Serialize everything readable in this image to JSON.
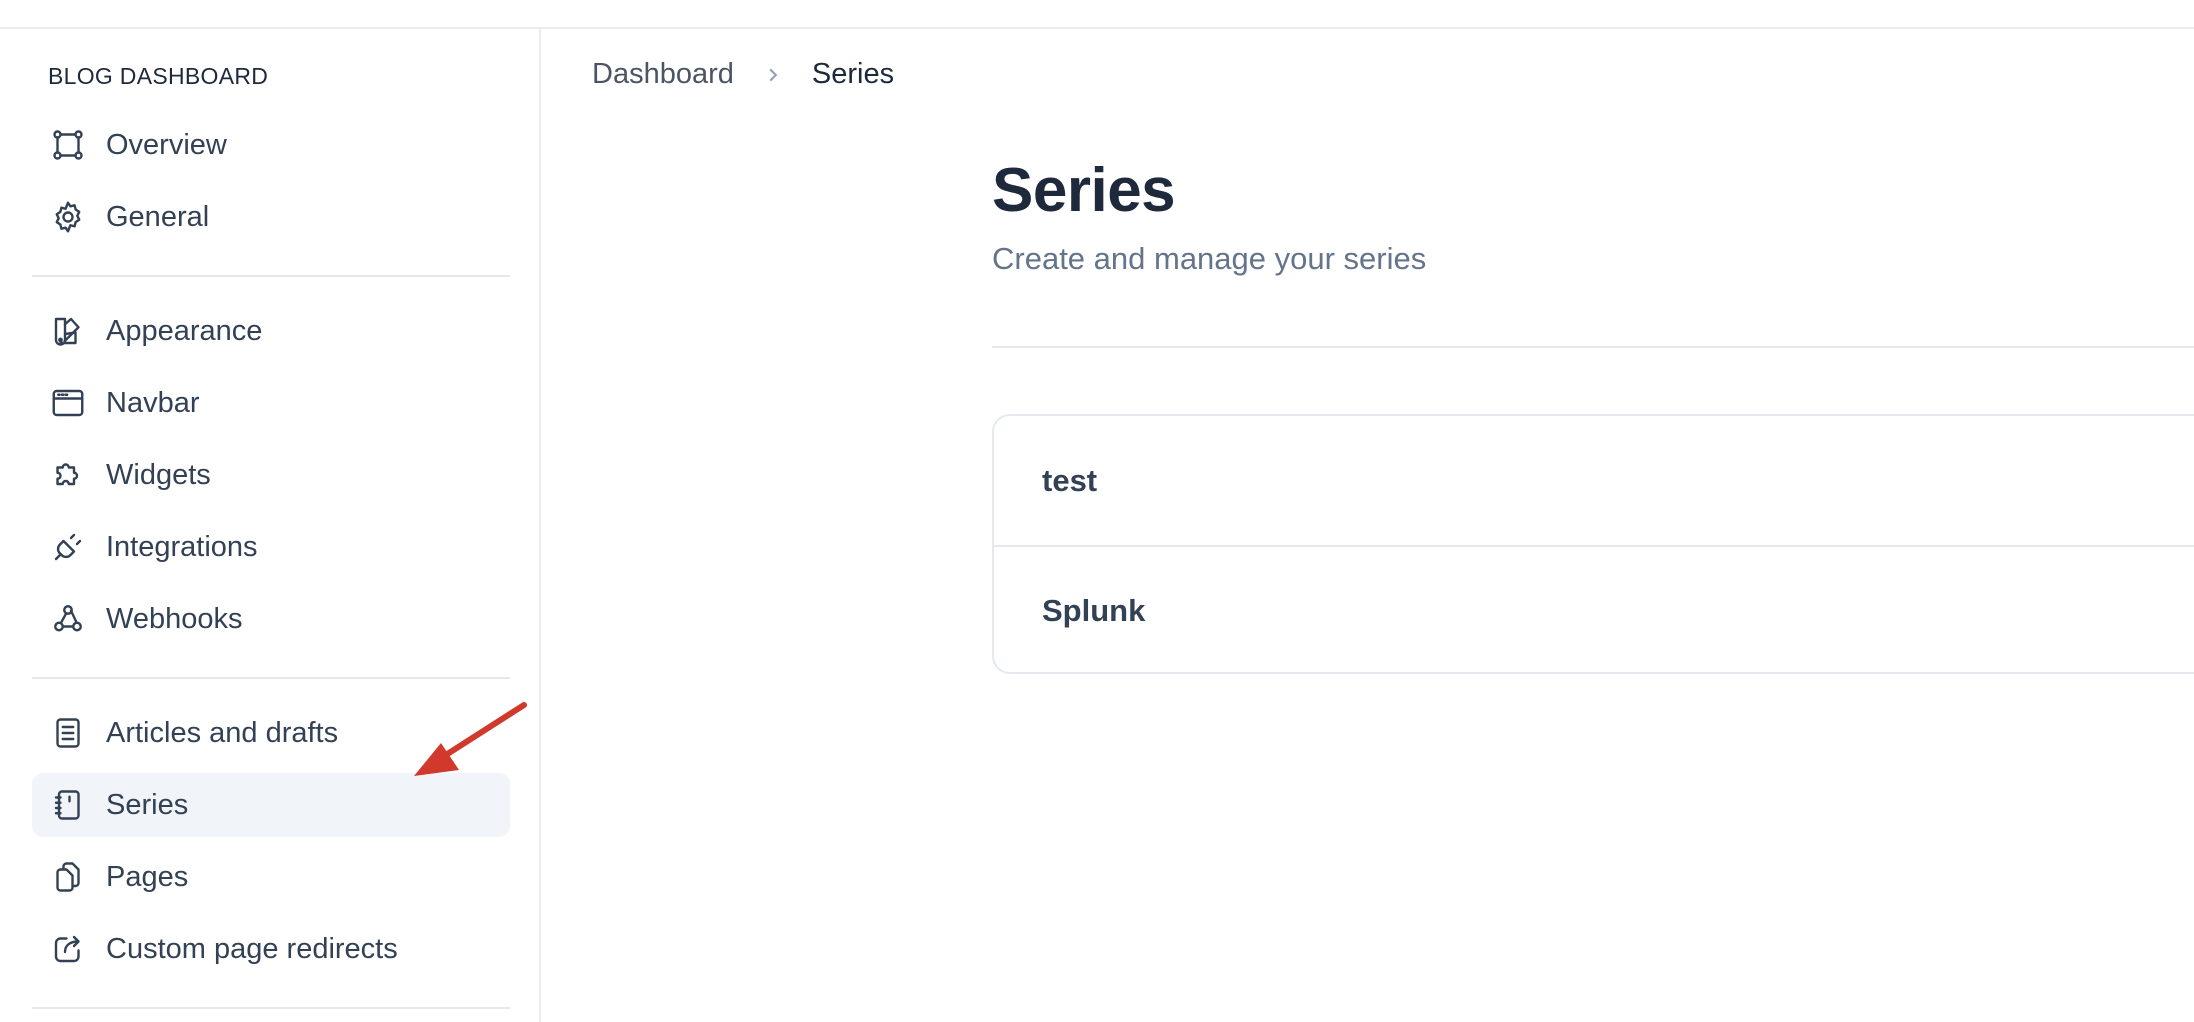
{
  "sidebar": {
    "title": "BLOG DASHBOARD",
    "items": [
      {
        "label": "Overview",
        "icon": "workflow-icon"
      },
      {
        "label": "General",
        "icon": "gear-icon"
      },
      {
        "label": "Appearance",
        "icon": "swatch-icon"
      },
      {
        "label": "Navbar",
        "icon": "browser-window-icon"
      },
      {
        "label": "Widgets",
        "icon": "puzzle-icon"
      },
      {
        "label": "Integrations",
        "icon": "plug-icon"
      },
      {
        "label": "Webhooks",
        "icon": "webhook-icon"
      },
      {
        "label": "Articles and drafts",
        "icon": "document-icon"
      },
      {
        "label": "Series",
        "icon": "notebook-icon",
        "active": true
      },
      {
        "label": "Pages",
        "icon": "pages-icon"
      },
      {
        "label": "Custom page redirects",
        "icon": "external-link-icon"
      }
    ]
  },
  "breadcrumb": {
    "items": [
      "Dashboard",
      "Series"
    ]
  },
  "main": {
    "title": "Series",
    "subtitle": "Create and manage your series",
    "series": [
      {
        "name": "test"
      },
      {
        "name": "Splunk"
      }
    ]
  },
  "colors": {
    "text": "#334155",
    "heading": "#1e293b",
    "muted": "#64748b",
    "active_bg": "#f1f4f9",
    "border": "#e5e9ef",
    "annotation_arrow": "#d0392b"
  }
}
